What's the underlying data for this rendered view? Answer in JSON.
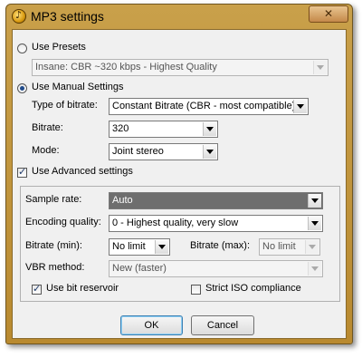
{
  "window": {
    "title": "MP3 settings",
    "close_glyph": "✕"
  },
  "presets": {
    "radio_label": "Use Presets",
    "selected": false,
    "value": "Insane: CBR ~320 kbps - Highest Quality",
    "enabled": false
  },
  "manual": {
    "radio_label": "Use Manual Settings",
    "selected": true,
    "type_label": "Type of bitrate:",
    "type_value": "Constant Bitrate (CBR - most compatible)",
    "bitrate_label": "Bitrate:",
    "bitrate_value": "320",
    "mode_label": "Mode:",
    "mode_value": "Joint stereo"
  },
  "advanced": {
    "check_label": "Use Advanced settings",
    "checked": true,
    "sample_rate_label": "Sample rate:",
    "sample_rate_value": "Auto",
    "encoding_label": "Encoding quality:",
    "encoding_value": "0 - Highest quality, very slow",
    "bitrate_min_label": "Bitrate (min):",
    "bitrate_min_value": "No limit",
    "bitrate_max_label": "Bitrate (max):",
    "bitrate_max_value": "No limit",
    "vbr_label": "VBR method:",
    "vbr_value": "New (faster)",
    "reservoir_label": "Use bit reservoir",
    "reservoir_checked": true,
    "iso_label": "Strict ISO compliance",
    "iso_checked": false
  },
  "buttons": {
    "ok": "OK",
    "cancel": "Cancel"
  }
}
